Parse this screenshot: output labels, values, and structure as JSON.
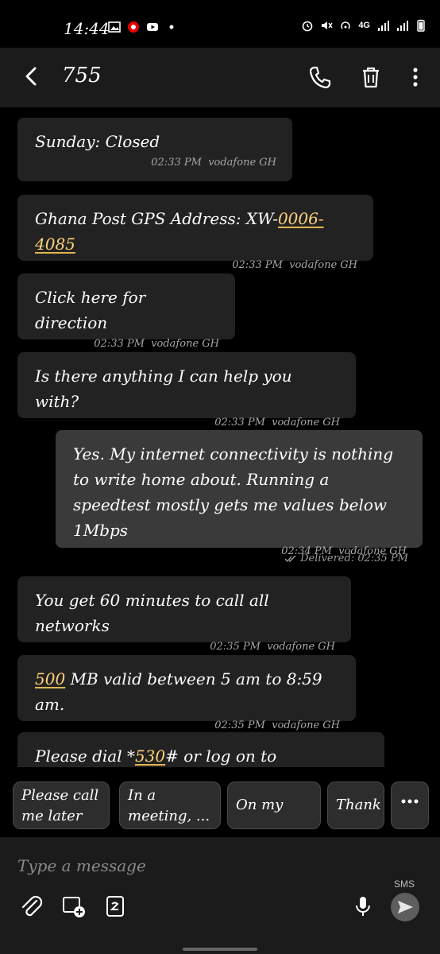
{
  "status_bar": {
    "time": "14:44",
    "network": "4G"
  },
  "header": {
    "contact": "755"
  },
  "messages": [
    {
      "direction": "in",
      "text": "Sunday: Closed",
      "time": "02:33 PM",
      "carrier": "vodafone GH"
    },
    {
      "direction": "in",
      "text_prefix": "Ghana Post GPS Address: XW-",
      "text_link": "0006-4085",
      "time": "02:33 PM",
      "carrier": "vodafone GH"
    },
    {
      "direction": "in",
      "text": "Click here for direction",
      "time": "02:33 PM",
      "carrier": "vodafone GH"
    },
    {
      "direction": "in",
      "text": "Is there anything I can help you with?",
      "time": "02:33 PM",
      "carrier": "vodafone GH"
    },
    {
      "direction": "out",
      "text": "Yes. My internet connectivity is nothing to write home about. Running a speedtest mostly gets me values below 1Mbps",
      "time": "02:34 PM",
      "carrier": "vodafone GH",
      "status": "Delivered: 02:35 PM"
    },
    {
      "direction": "in",
      "text": "You get 60 minutes to call all networks",
      "time": "02:35 PM",
      "carrier": "vodafone GH"
    },
    {
      "direction": "in",
      "text_link": "500",
      "text_suffix": " MB valid between 5 am to 8:59 am.",
      "time": "02:35 PM",
      "carrier": "vodafone GH"
    },
    {
      "direction": "in",
      "text_prefix": "Please dial *",
      "text_link": "530",
      "text_suffix": "# or log on to"
    }
  ],
  "quick_replies": [
    "Please call me later",
    "In a meeting, ...",
    "On my way",
    "Thank"
  ],
  "composer": {
    "placeholder": "Type a message",
    "mode_label": "SMS"
  },
  "colors": {
    "background": "#000000",
    "bubble_in": "#222222",
    "bubble_out": "#3a3a3a",
    "link_underline": "#e0b552"
  }
}
